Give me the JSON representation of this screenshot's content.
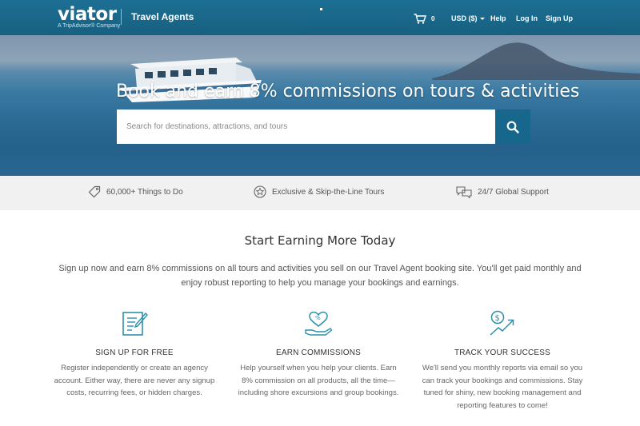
{
  "header": {
    "logo": "viator",
    "logo_sub": "A TripAdvisor® Company",
    "section": "Travel Agents",
    "cart_count": "0",
    "currency": "USD ($)",
    "help": "Help",
    "login": "Log In",
    "signup": "Sign Up"
  },
  "hero": {
    "title": "Book and earn 8% commissions on tours & activities",
    "search_placeholder": "Search for destinations, attractions, and tours"
  },
  "features": [
    {
      "label": "60,000+ Things to Do",
      "icon": "tag-icon"
    },
    {
      "label": "Exclusive & Skip-the-Line Tours",
      "icon": "star-badge-icon"
    },
    {
      "label": "24/7 Global Support",
      "icon": "chat-bubbles-icon"
    }
  ],
  "main": {
    "title": "Start Earning More Today",
    "intro": "Sign up now and earn 8% commissions on all tours and activities you sell on our Travel Agent booking site. You'll get paid monthly and enjoy robust reporting to help you manage your bookings and earnings.",
    "columns": [
      {
        "title": "SIGN UP FOR FREE",
        "desc": "Register independently or create an agency account. Either way, there are never any signup costs, recurring fees, or hidden charges.",
        "icon": "signup-form-icon"
      },
      {
        "title": "EARN COMMISSIONS",
        "desc": "Help yourself when you help your clients. Earn 8% commission on all products, all the time—including shore excursions and group bookings.",
        "icon": "heart-percent-hand-icon"
      },
      {
        "title": "TRACK YOUR SUCCESS",
        "desc": "We'll send you monthly reports via email so you can track your bookings and commissions. Stay tuned for shiny, new booking management and reporting features to come!",
        "icon": "dollar-growth-icon"
      }
    ]
  },
  "colors": {
    "header_bg": "#1a6a8f",
    "accent": "#17678d",
    "icon_teal": "#2c8fab"
  }
}
